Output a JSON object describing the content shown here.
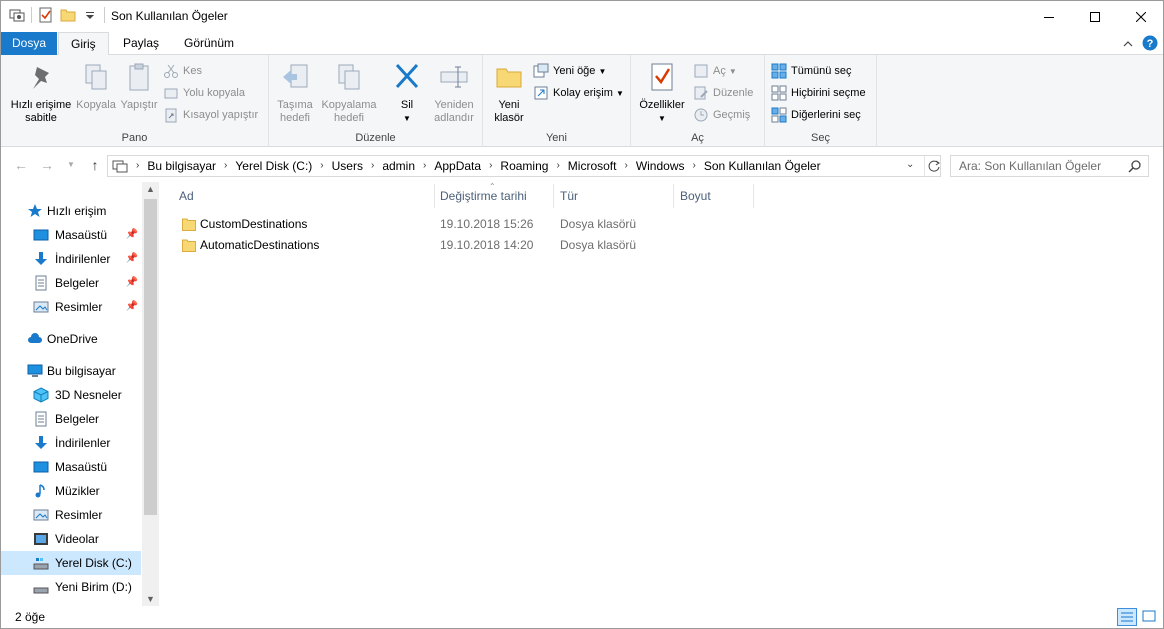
{
  "window": {
    "title": "Son Kullanılan Ögeler"
  },
  "tabs": [
    {
      "label": "Dosya"
    },
    {
      "label": "Giriş"
    },
    {
      "label": "Paylaş"
    },
    {
      "label": "Görünüm"
    }
  ],
  "ribbon": {
    "pano": {
      "label": "Pano",
      "pin_label_1": "Hızlı erişime",
      "pin_label_2": "sabitle",
      "copy_label": "Kopyala",
      "paste_label": "Yapıştır",
      "cut_label": "Kes",
      "copy_path_label": "Yolu kopyala",
      "paste_shortcut_label": "Kısayol yapıştır"
    },
    "duzenle": {
      "label": "Düzenle",
      "move_1": "Taşıma",
      "move_2": "hedefi",
      "copyto_1": "Kopyalama",
      "copyto_2": "hedefi",
      "delete": "Sil",
      "rename_1": "Yeniden",
      "rename_2": "adlandır"
    },
    "yeni": {
      "label": "Yeni",
      "new_folder_1": "Yeni",
      "new_folder_2": "klasör",
      "new_item": "Yeni öğe",
      "easy_access": "Kolay erişim"
    },
    "ac": {
      "label": "Aç",
      "properties": "Özellikler",
      "open": "Aç",
      "edit": "Düzenle",
      "history": "Geçmiş"
    },
    "sec": {
      "label": "Seç",
      "select_all": "Tümünü seç",
      "select_none": "Hiçbirini seçme",
      "invert": "Diğerlerini seç"
    }
  },
  "address": {
    "crumbs": [
      "Bu bilgisayar",
      "Yerel Disk (C:)",
      "Users",
      "admin",
      "AppData",
      "Roaming",
      "Microsoft",
      "Windows",
      "Son Kullanılan Ögeler"
    ],
    "search_placeholder": "Ara: Son Kullanılan Ögeler"
  },
  "navpane": {
    "items": [
      {
        "label": "Hızlı erişim",
        "icon": "star-icon"
      },
      {
        "label": "Masaüstü",
        "icon": "desktop-icon"
      },
      {
        "label": "İndirilenler",
        "icon": "download-icon"
      },
      {
        "label": "Belgeler",
        "icon": "documents-icon"
      },
      {
        "label": "Resimler",
        "icon": "pictures-icon"
      },
      {
        "label": "OneDrive",
        "icon": "cloud-icon"
      },
      {
        "label": "Bu bilgisayar",
        "icon": "computer-icon"
      },
      {
        "label": "3D Nesneler",
        "icon": "cube-icon"
      },
      {
        "label": "Belgeler",
        "icon": "documents-icon"
      },
      {
        "label": "İndirilenler",
        "icon": "download-icon"
      },
      {
        "label": "Masaüstü",
        "icon": "desktop-icon"
      },
      {
        "label": "Müzikler",
        "icon": "music-icon"
      },
      {
        "label": "Resimler",
        "icon": "pictures-icon"
      },
      {
        "label": "Videolar",
        "icon": "video-icon"
      },
      {
        "label": "Yerel Disk (C:)",
        "icon": "drive-icon"
      },
      {
        "label": "Yeni Birim (D:)",
        "icon": "drive-icon"
      }
    ]
  },
  "columns": [
    "Ad",
    "Değiştirme tarihi",
    "Tür",
    "Boyut"
  ],
  "files": [
    {
      "name": "CustomDestinations",
      "date": "19.10.2018 15:26",
      "type": "Dosya klasörü",
      "size": ""
    },
    {
      "name": "AutomaticDestinations",
      "date": "19.10.2018 14:20",
      "type": "Dosya klasörü",
      "size": ""
    }
  ],
  "status": {
    "count": "2 öğe"
  },
  "colors": {
    "accent": "#1979ca",
    "selection": "#cce8ff",
    "folder": "#f8d775"
  }
}
